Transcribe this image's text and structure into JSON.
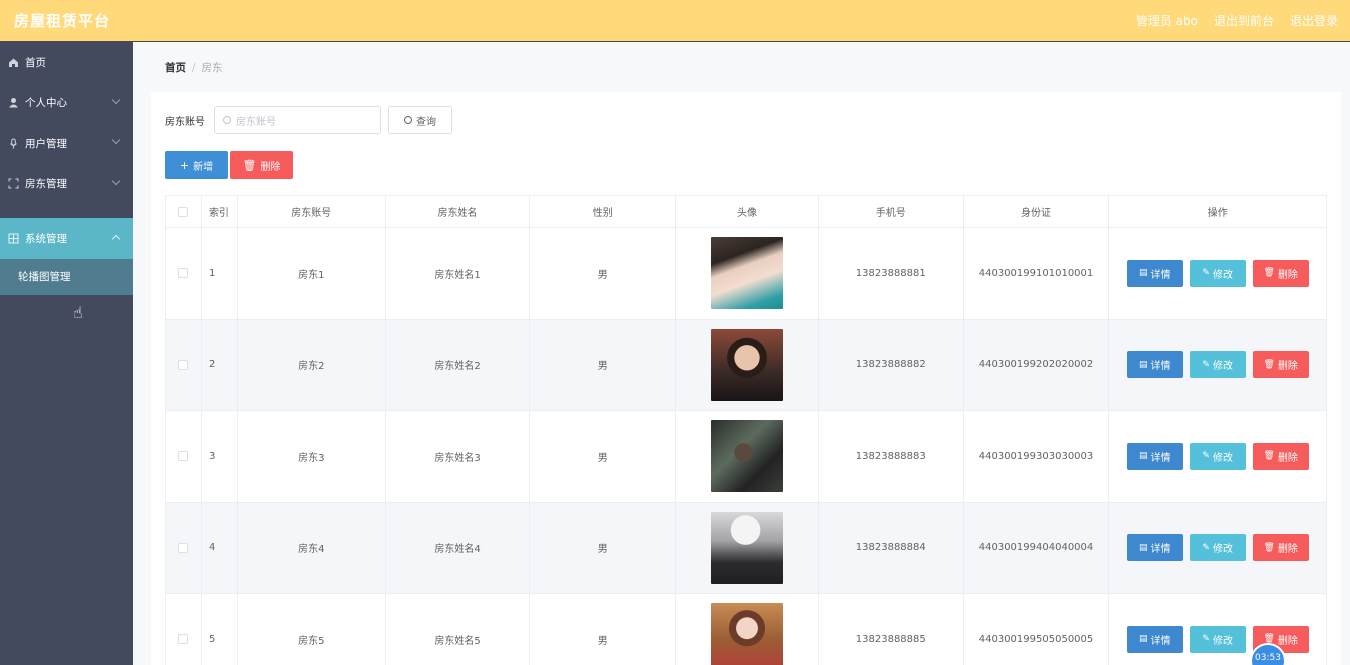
{
  "app": {
    "title": "房屋租赁平台"
  },
  "topbar": {
    "user": "管理员 abo",
    "back_to_front": "退出到前台",
    "logout": "退出登录"
  },
  "sidebar": {
    "items": [
      {
        "label": "首页",
        "icon": "home-icon"
      },
      {
        "label": "个人中心",
        "icon": "user-icon"
      },
      {
        "label": "用户管理",
        "icon": "mic-icon"
      },
      {
        "label": "房东管理",
        "icon": "frame-icon"
      },
      {
        "label": "系统管理",
        "icon": "grid-icon"
      }
    ],
    "submenu": [
      {
        "label": "轮播图管理"
      }
    ]
  },
  "breadcrumb": {
    "home": "首页",
    "sep": "/",
    "current": "房东"
  },
  "search": {
    "label": "房东账号",
    "placeholder": "房东账号",
    "button": "查询"
  },
  "actions": {
    "add": "新增",
    "delete": "删除"
  },
  "table": {
    "headers": {
      "index": "索引",
      "account": "房东账号",
      "name": "房东姓名",
      "gender": "性别",
      "avatar": "头像",
      "phone": "手机号",
      "idcard": "身份证",
      "ops": "操作"
    },
    "op_labels": {
      "detail": "详情",
      "edit": "修改",
      "delete": "删除"
    },
    "rows": [
      {
        "index": "1",
        "account": "房东1",
        "name": "房东姓名1",
        "gender": "男",
        "phone": "13823888881",
        "idcard": "440300199101010001"
      },
      {
        "index": "2",
        "account": "房东2",
        "name": "房东姓名2",
        "gender": "男",
        "phone": "13823888882",
        "idcard": "440300199202020002"
      },
      {
        "index": "3",
        "account": "房东3",
        "name": "房东姓名3",
        "gender": "男",
        "phone": "13823888883",
        "idcard": "440300199303030003"
      },
      {
        "index": "4",
        "account": "房东4",
        "name": "房东姓名4",
        "gender": "男",
        "phone": "13823888884",
        "idcard": "440300199404040004"
      },
      {
        "index": "5",
        "account": "房东5",
        "name": "房东姓名5",
        "gender": "男",
        "phone": "13823888885",
        "idcard": "440300199505050005"
      }
    ]
  },
  "timer": {
    "label": "03:53"
  },
  "colors": {
    "topbar": "#ffd97a",
    "sidebar": "#434a5e",
    "active": "#5bb6c8",
    "primary": "#3e8fd6",
    "danger": "#f65c5c",
    "info": "#55c0d9"
  }
}
